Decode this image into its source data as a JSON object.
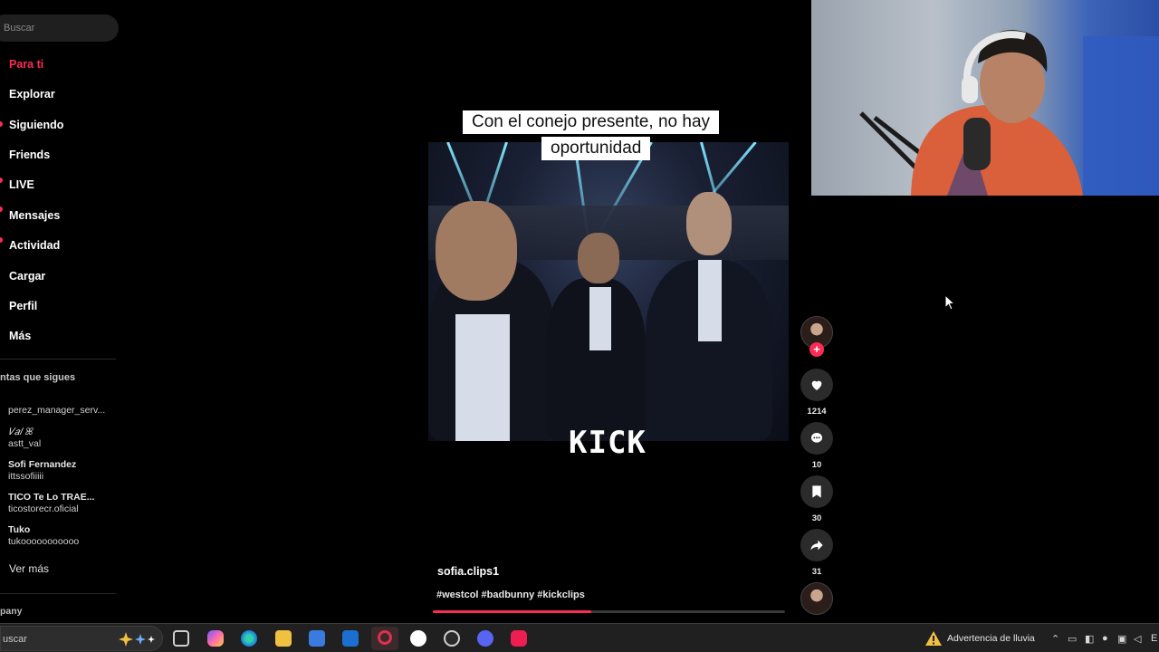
{
  "sidebar": {
    "search_placeholder": "Buscar",
    "nav": [
      "Para ti",
      "Explorar",
      "Siguiendo",
      "Friends",
      "LIVE",
      "Mensajes",
      "Actividad",
      "Cargar",
      "Perfil",
      "Más"
    ],
    "following_title": "ntas que sigues",
    "accounts": [
      {
        "name": "perez_manager_serv..."
      },
      {
        "name": "𝑉𝑎𝑙 ꕤ",
        "user": "astt_val"
      },
      {
        "name": "Sofi Fernandez",
        "user": "ittssofiiiii"
      },
      {
        "name": "TICO Te Lo TRAE...",
        "user": "ticostorecr.oficial"
      },
      {
        "name": "Tuko",
        "user": "tukooooooooooo"
      }
    ],
    "see_more": "Ver más",
    "company": "pany"
  },
  "video": {
    "caption_line1": "Con el conejo presente, no hay",
    "caption_line2": "oportunidad",
    "watermark": "KICK",
    "author": "sofia.clips1",
    "hashtags": "#westcol #badbunny #kickclips",
    "progress": 0.45
  },
  "actions": {
    "likes": "1214",
    "comments": "10",
    "saves": "30",
    "shares": "31"
  },
  "taskbar": {
    "search_placeholder": "uscar",
    "weather": "Advertencia de lluvia",
    "tray_text": "E"
  },
  "colors": {
    "accent": "#fe2c55",
    "background": "#000000",
    "taskbar": "#202020"
  }
}
